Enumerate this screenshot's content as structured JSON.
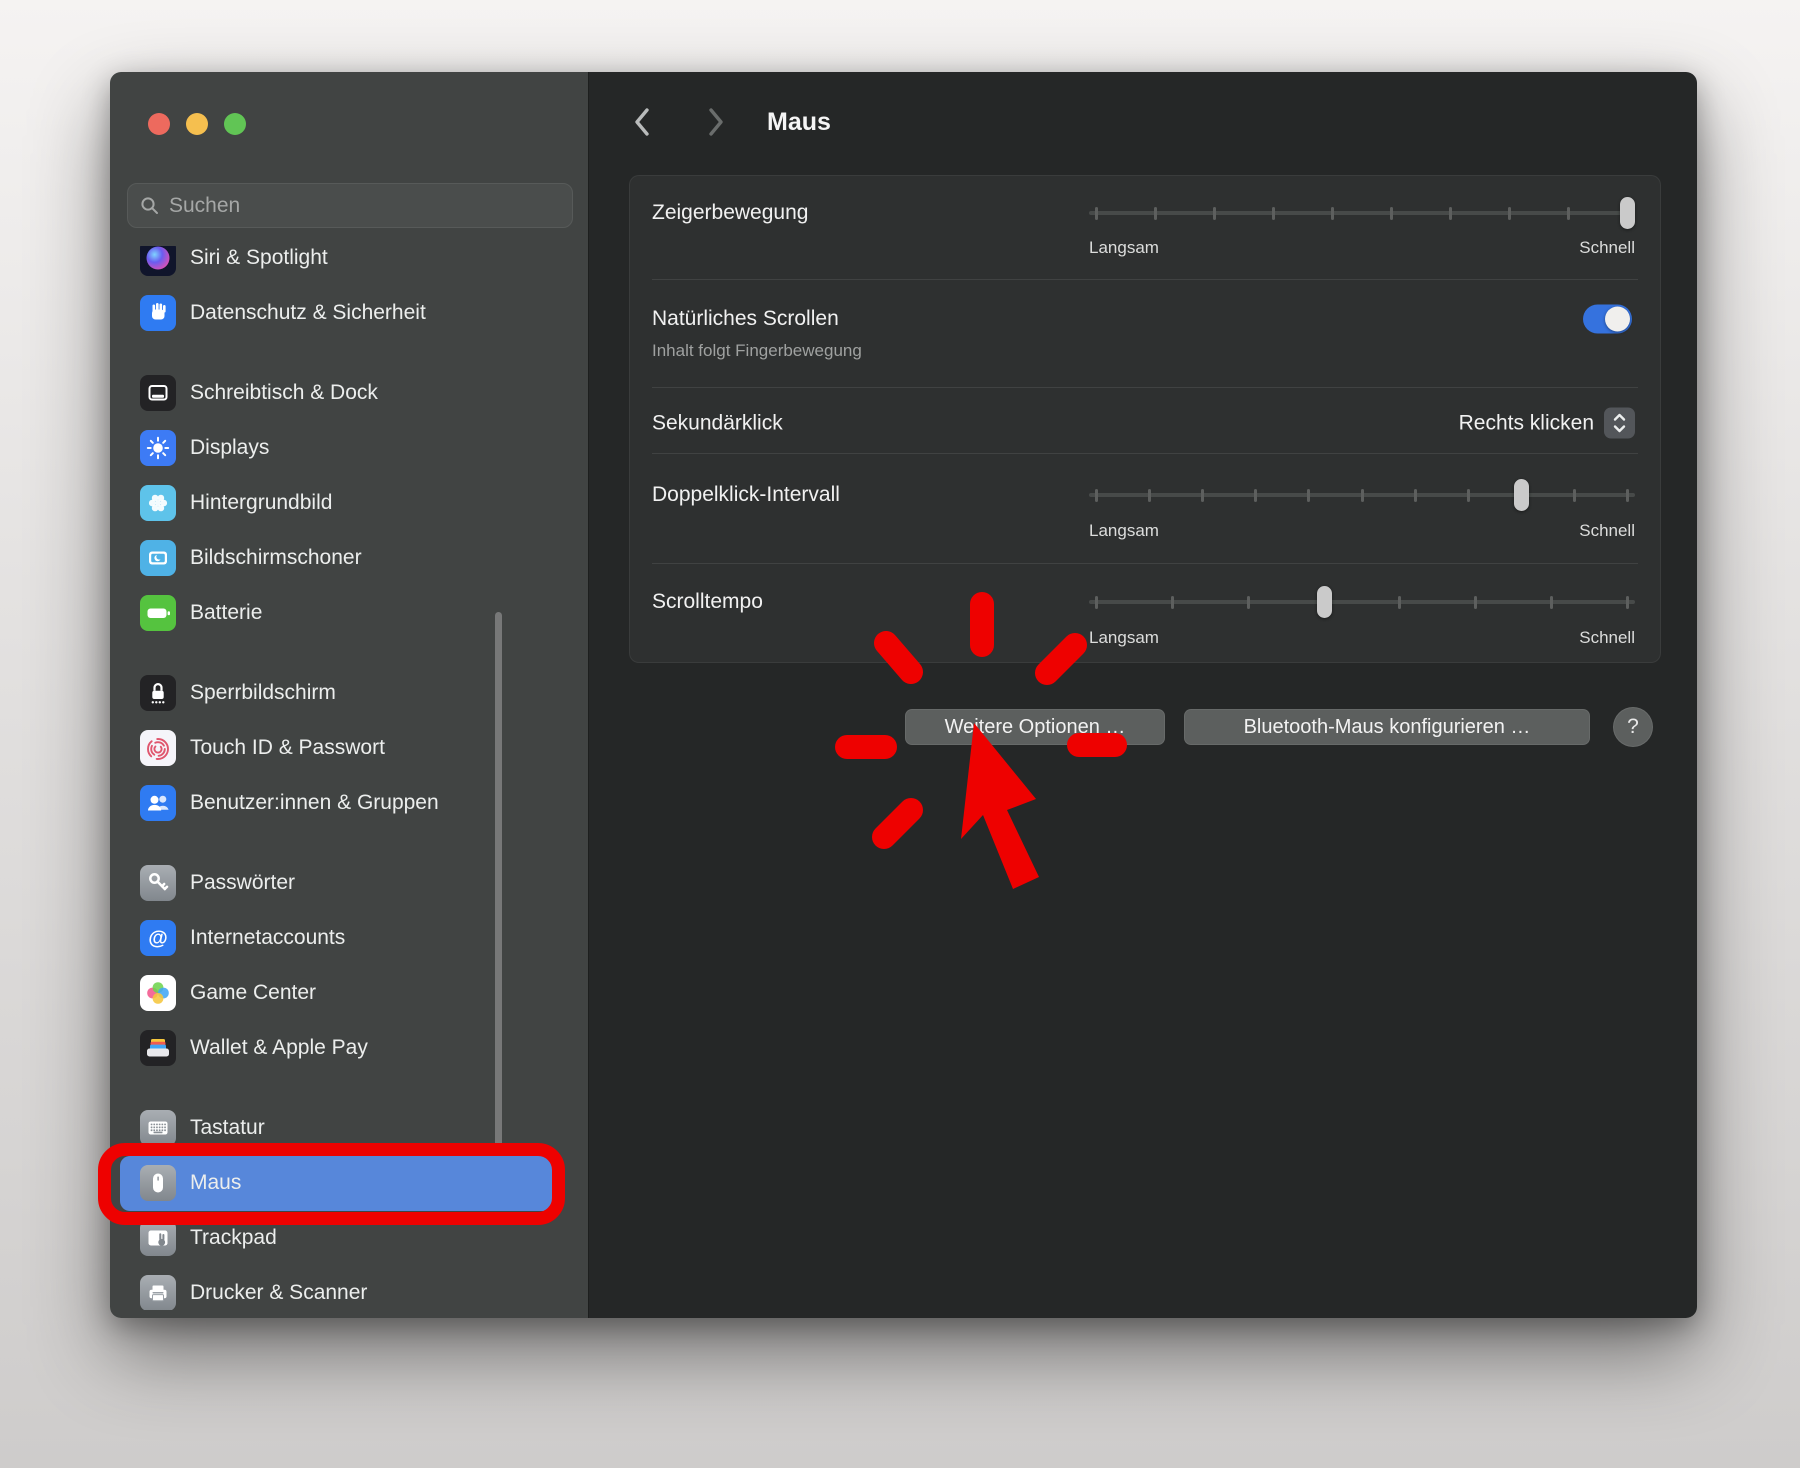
{
  "window_title": "Maus",
  "colors": {
    "sidebar_bg": "#414443",
    "content_bg": "#252727",
    "card_bg": "#2e3030",
    "selection_blue": "#5787da",
    "toggle_blue": "#3572de",
    "annotation_red": "#ee0100",
    "traffic_red": "#ed6a5e",
    "traffic_yellow": "#f5bf4f",
    "traffic_green": "#61c555"
  },
  "sidebar": {
    "search_placeholder": "Suchen",
    "groups": [
      {
        "items": [
          {
            "id": "siri",
            "label": "Siri & Spotlight",
            "icon": "siri-icon"
          },
          {
            "id": "privacy",
            "label": "Datenschutz & Sicherheit",
            "icon": "privacy-hand-icon"
          }
        ]
      },
      {
        "items": [
          {
            "id": "desktop-dock",
            "label": "Schreibtisch & Dock",
            "icon": "desktop-dock-icon"
          },
          {
            "id": "displays",
            "label": "Displays",
            "icon": "displays-sun-icon"
          },
          {
            "id": "wallpaper",
            "label": "Hintergrundbild",
            "icon": "wallpaper-flower-icon"
          },
          {
            "id": "screensaver",
            "label": "Bildschirmschoner",
            "icon": "screensaver-icon"
          },
          {
            "id": "battery",
            "label": "Batterie",
            "icon": "battery-icon"
          }
        ]
      },
      {
        "items": [
          {
            "id": "lock-screen",
            "label": "Sperrbildschirm",
            "icon": "lock-icon"
          },
          {
            "id": "touch-id",
            "label": "Touch ID & Passwort",
            "icon": "fingerprint-icon"
          },
          {
            "id": "users-groups",
            "label": "Benutzer:innen & Gruppen",
            "icon": "users-icon"
          }
        ]
      },
      {
        "items": [
          {
            "id": "passwords",
            "label": "Passwörter",
            "icon": "key-icon"
          },
          {
            "id": "internet-accounts",
            "label": "Internetaccounts",
            "icon": "at-sign-icon"
          },
          {
            "id": "game-center",
            "label": "Game Center",
            "icon": "game-center-icon"
          },
          {
            "id": "wallet",
            "label": "Wallet & Apple Pay",
            "icon": "wallet-icon"
          }
        ]
      },
      {
        "items": [
          {
            "id": "keyboard",
            "label": "Tastatur",
            "icon": "keyboard-icon"
          },
          {
            "id": "mouse",
            "label": "Maus",
            "icon": "mouse-icon",
            "selected": true,
            "annotated": true
          },
          {
            "id": "trackpad",
            "label": "Trackpad",
            "icon": "trackpad-icon"
          },
          {
            "id": "printers",
            "label": "Drucker & Scanner",
            "icon": "printer-icon"
          }
        ]
      }
    ]
  },
  "content": {
    "nav_title": "Maus",
    "rows": {
      "pointer_speed": {
        "label": "Zeigerbewegung",
        "min_label": "Langsam",
        "max_label": "Schnell",
        "ticks": 10,
        "value": 1.0
      },
      "natural_scrolling": {
        "label": "Natürliches Scrollen",
        "sublabel": "Inhalt folgt Fingerbewegung",
        "enabled": true
      },
      "secondary_click": {
        "label": "Sekundärklick",
        "value": "Rechts klicken"
      },
      "double_click": {
        "label": "Doppelklick-Intervall",
        "min_label": "Langsam",
        "max_label": "Schnell",
        "ticks": 11,
        "value": 0.8
      },
      "scroll_speed": {
        "label": "Scrolltempo",
        "min_label": "Langsam",
        "max_label": "Schnell",
        "ticks": 8,
        "value": 0.43
      }
    },
    "actions": {
      "more_options": "Weitere Optionen …",
      "configure_bluetooth": "Bluetooth-Maus konfigurieren …",
      "help": "?"
    }
  },
  "annotation": {
    "type": "click-burst",
    "target": "Weitere Optionen …",
    "color": "#ee0100"
  }
}
